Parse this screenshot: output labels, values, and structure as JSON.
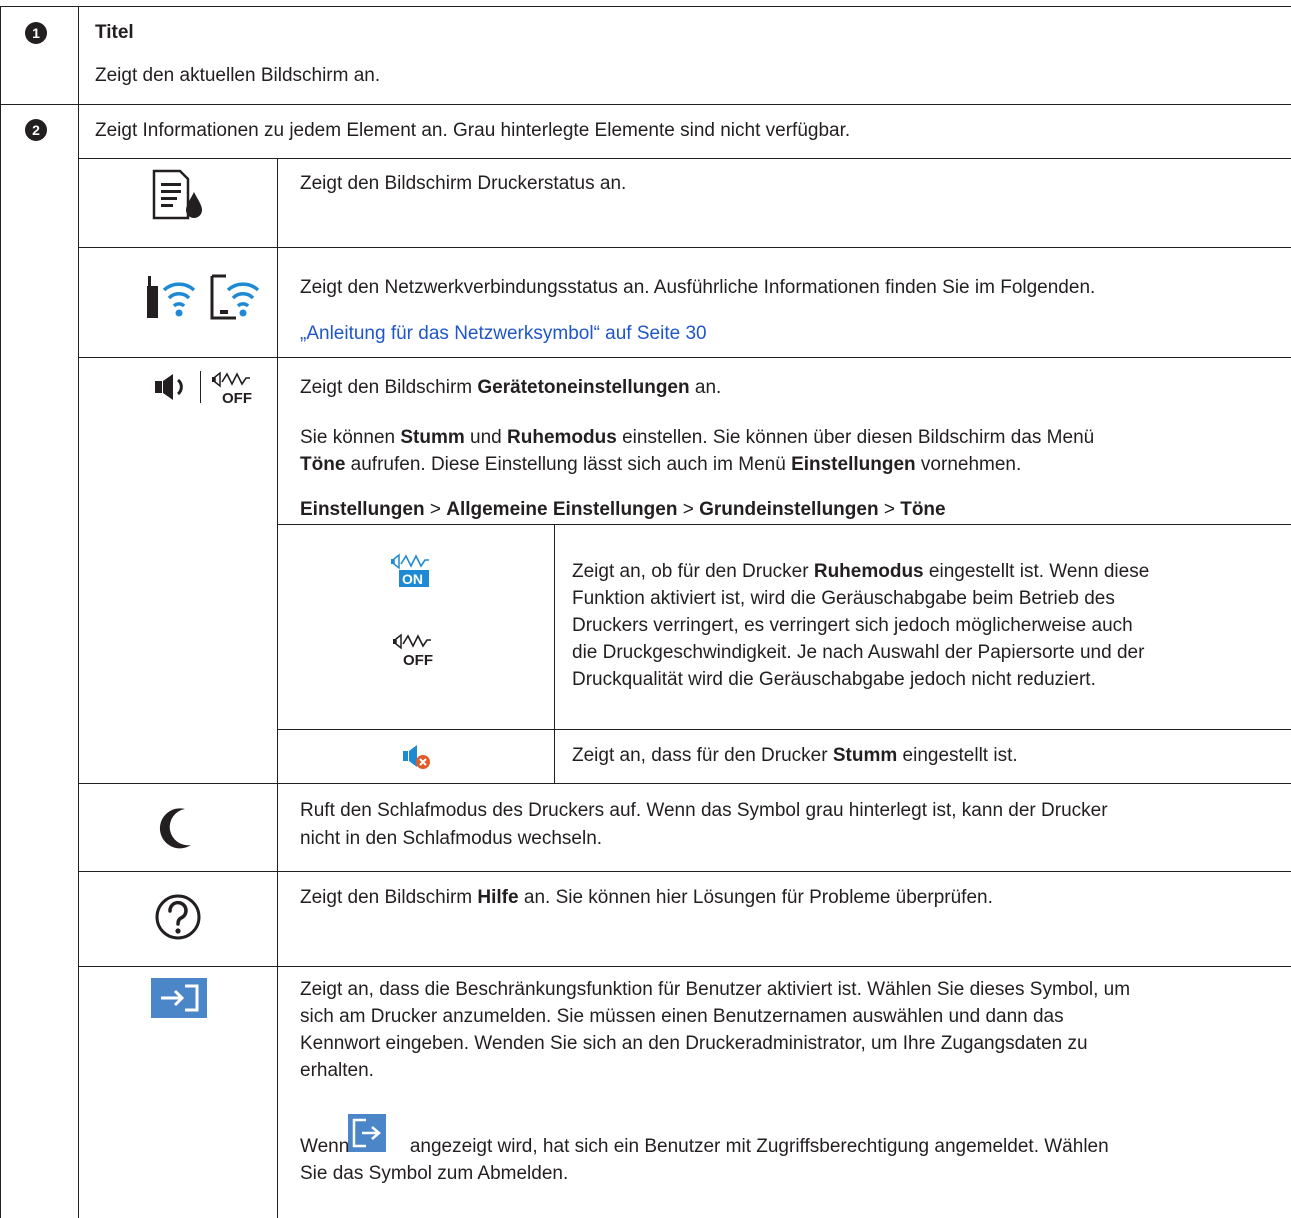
{
  "row1": {
    "number": "1",
    "title": "Titel",
    "desc": "Zeigt den aktuellen Bildschirm an."
  },
  "row2": {
    "number": "2",
    "intro": "Zeigt Informationen zu jedem Element an. Grau hinterlegte Elemente sind nicht verfügbar.",
    "status": {
      "icon": "printer-status-icon",
      "text": "Zeigt den Bildschirm Druckerstatus an."
    },
    "network": {
      "icons": [
        "wifi-router-icon",
        "wifi-device-icon"
      ],
      "text": "Zeigt den Netzwerkverbindungsstatus an. Ausführliche Informationen finden Sie im Folgenden.",
      "link": "„Anleitung für das Netzwerksymbol“ auf Seite 30"
    },
    "sound": {
      "icons": [
        "speaker-icon",
        "quiet-off-icon"
      ],
      "l1a": "Zeigt den Bildschirm ",
      "l1b": "Gerätetoneinstellungen",
      "l1c": " an.",
      "l2a": "Sie können ",
      "l2b": "Stumm",
      "l2c": " und ",
      "l2d": "Ruhemodus",
      "l2e": " einstellen. Sie können über diesen Bildschirm das Menü",
      "l3a": "Töne",
      "l3b": " aufrufen. Diese Einstellung lässt sich auch im Menü ",
      "l3c": "Einstellungen",
      "l3d": " vornehmen.",
      "path": [
        "Einstellungen",
        "Allgemeine Einstellungen",
        "Grundeinstellungen",
        "Töne"
      ],
      "sep": " > ",
      "quiet": {
        "icons": [
          "quiet-on-icon",
          "quiet-off-icon"
        ],
        "on_label": "ON",
        "off_label": "OFF",
        "l1a": "Zeigt an, ob für den Drucker ",
        "l1b": "Ruhemodus",
        "l1c": " eingestellt ist. Wenn diese",
        "l2": "Funktion aktiviert ist, wird die Geräuschabgabe beim Betrieb des",
        "l3": "Druckers verringert, es verringert sich jedoch möglicherweise auch",
        "l4": "die Druckgeschwindigkeit. Je nach Auswahl der Papiersorte und der",
        "l5": "Druckqualität wird die Geräuschabgabe jedoch nicht reduziert."
      },
      "mute": {
        "icon": "mute-icon",
        "a": "Zeigt an, dass für den Drucker ",
        "b": "Stumm",
        "c": " eingestellt ist."
      }
    },
    "sleep": {
      "icon": "moon-icon",
      "l1": "Ruft den Schlafmodus des Druckers auf. Wenn das Symbol grau hinterlegt ist, kann der Drucker",
      "l2": "nicht in den Schlafmodus wechseln."
    },
    "help": {
      "icon": "help-icon",
      "a": "Zeigt den Bildschirm ",
      "b": "Hilfe",
      "c": " an. Sie können hier Lösungen für Probleme überprüfen."
    },
    "login": {
      "icon": "login-icon",
      "l1": "Zeigt an, dass die Beschränkungsfunktion für Benutzer aktiviert ist. Wählen Sie dieses Symbol, um",
      "l2": "sich am Drucker anzumelden. Sie müssen einen Benutzernamen auswählen und dann das",
      "l3": "Kennwort eingeben. Wenden Sie sich an den Druckeradministrator, um Ihre Zugangsdaten zu",
      "l4": "erhalten.",
      "l5a": "Wenn ",
      "l5icon": "logout-icon",
      "l5b": " angezeigt wird, hat sich ein Benutzer mit Zugriffsberechtigung angemeldet. Wählen",
      "l6": "Sie das Symbol zum Abmelden."
    }
  },
  "colors": {
    "text": "#231f20",
    "link": "#1f56c9",
    "icon_blue": "#1f8ad4",
    "login_bg": "#4a86c8",
    "mute_red": "#e05a2a"
  }
}
